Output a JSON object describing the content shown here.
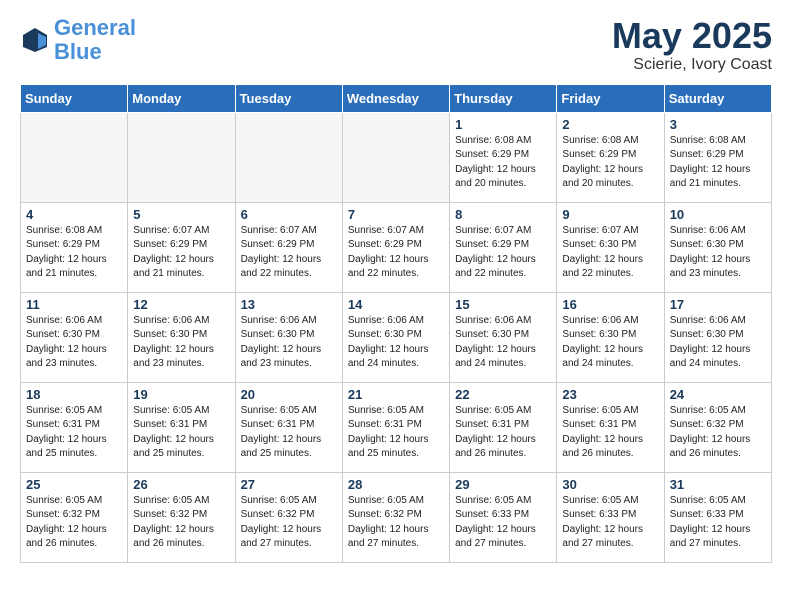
{
  "header": {
    "logo_line1": "General",
    "logo_line2": "Blue",
    "month": "May 2025",
    "location": "Scierie, Ivory Coast"
  },
  "days_of_week": [
    "Sunday",
    "Monday",
    "Tuesday",
    "Wednesday",
    "Thursday",
    "Friday",
    "Saturday"
  ],
  "weeks": [
    [
      {
        "num": "",
        "info": ""
      },
      {
        "num": "",
        "info": ""
      },
      {
        "num": "",
        "info": ""
      },
      {
        "num": "",
        "info": ""
      },
      {
        "num": "1",
        "info": "Sunrise: 6:08 AM\nSunset: 6:29 PM\nDaylight: 12 hours\nand 20 minutes."
      },
      {
        "num": "2",
        "info": "Sunrise: 6:08 AM\nSunset: 6:29 PM\nDaylight: 12 hours\nand 20 minutes."
      },
      {
        "num": "3",
        "info": "Sunrise: 6:08 AM\nSunset: 6:29 PM\nDaylight: 12 hours\nand 21 minutes."
      }
    ],
    [
      {
        "num": "4",
        "info": "Sunrise: 6:08 AM\nSunset: 6:29 PM\nDaylight: 12 hours\nand 21 minutes."
      },
      {
        "num": "5",
        "info": "Sunrise: 6:07 AM\nSunset: 6:29 PM\nDaylight: 12 hours\nand 21 minutes."
      },
      {
        "num": "6",
        "info": "Sunrise: 6:07 AM\nSunset: 6:29 PM\nDaylight: 12 hours\nand 22 minutes."
      },
      {
        "num": "7",
        "info": "Sunrise: 6:07 AM\nSunset: 6:29 PM\nDaylight: 12 hours\nand 22 minutes."
      },
      {
        "num": "8",
        "info": "Sunrise: 6:07 AM\nSunset: 6:29 PM\nDaylight: 12 hours\nand 22 minutes."
      },
      {
        "num": "9",
        "info": "Sunrise: 6:07 AM\nSunset: 6:30 PM\nDaylight: 12 hours\nand 22 minutes."
      },
      {
        "num": "10",
        "info": "Sunrise: 6:06 AM\nSunset: 6:30 PM\nDaylight: 12 hours\nand 23 minutes."
      }
    ],
    [
      {
        "num": "11",
        "info": "Sunrise: 6:06 AM\nSunset: 6:30 PM\nDaylight: 12 hours\nand 23 minutes."
      },
      {
        "num": "12",
        "info": "Sunrise: 6:06 AM\nSunset: 6:30 PM\nDaylight: 12 hours\nand 23 minutes."
      },
      {
        "num": "13",
        "info": "Sunrise: 6:06 AM\nSunset: 6:30 PM\nDaylight: 12 hours\nand 23 minutes."
      },
      {
        "num": "14",
        "info": "Sunrise: 6:06 AM\nSunset: 6:30 PM\nDaylight: 12 hours\nand 24 minutes."
      },
      {
        "num": "15",
        "info": "Sunrise: 6:06 AM\nSunset: 6:30 PM\nDaylight: 12 hours\nand 24 minutes."
      },
      {
        "num": "16",
        "info": "Sunrise: 6:06 AM\nSunset: 6:30 PM\nDaylight: 12 hours\nand 24 minutes."
      },
      {
        "num": "17",
        "info": "Sunrise: 6:06 AM\nSunset: 6:30 PM\nDaylight: 12 hours\nand 24 minutes."
      }
    ],
    [
      {
        "num": "18",
        "info": "Sunrise: 6:05 AM\nSunset: 6:31 PM\nDaylight: 12 hours\nand 25 minutes."
      },
      {
        "num": "19",
        "info": "Sunrise: 6:05 AM\nSunset: 6:31 PM\nDaylight: 12 hours\nand 25 minutes."
      },
      {
        "num": "20",
        "info": "Sunrise: 6:05 AM\nSunset: 6:31 PM\nDaylight: 12 hours\nand 25 minutes."
      },
      {
        "num": "21",
        "info": "Sunrise: 6:05 AM\nSunset: 6:31 PM\nDaylight: 12 hours\nand 25 minutes."
      },
      {
        "num": "22",
        "info": "Sunrise: 6:05 AM\nSunset: 6:31 PM\nDaylight: 12 hours\nand 26 minutes."
      },
      {
        "num": "23",
        "info": "Sunrise: 6:05 AM\nSunset: 6:31 PM\nDaylight: 12 hours\nand 26 minutes."
      },
      {
        "num": "24",
        "info": "Sunrise: 6:05 AM\nSunset: 6:32 PM\nDaylight: 12 hours\nand 26 minutes."
      }
    ],
    [
      {
        "num": "25",
        "info": "Sunrise: 6:05 AM\nSunset: 6:32 PM\nDaylight: 12 hours\nand 26 minutes."
      },
      {
        "num": "26",
        "info": "Sunrise: 6:05 AM\nSunset: 6:32 PM\nDaylight: 12 hours\nand 26 minutes."
      },
      {
        "num": "27",
        "info": "Sunrise: 6:05 AM\nSunset: 6:32 PM\nDaylight: 12 hours\nand 27 minutes."
      },
      {
        "num": "28",
        "info": "Sunrise: 6:05 AM\nSunset: 6:32 PM\nDaylight: 12 hours\nand 27 minutes."
      },
      {
        "num": "29",
        "info": "Sunrise: 6:05 AM\nSunset: 6:33 PM\nDaylight: 12 hours\nand 27 minutes."
      },
      {
        "num": "30",
        "info": "Sunrise: 6:05 AM\nSunset: 6:33 PM\nDaylight: 12 hours\nand 27 minutes."
      },
      {
        "num": "31",
        "info": "Sunrise: 6:05 AM\nSunset: 6:33 PM\nDaylight: 12 hours\nand 27 minutes."
      }
    ]
  ]
}
